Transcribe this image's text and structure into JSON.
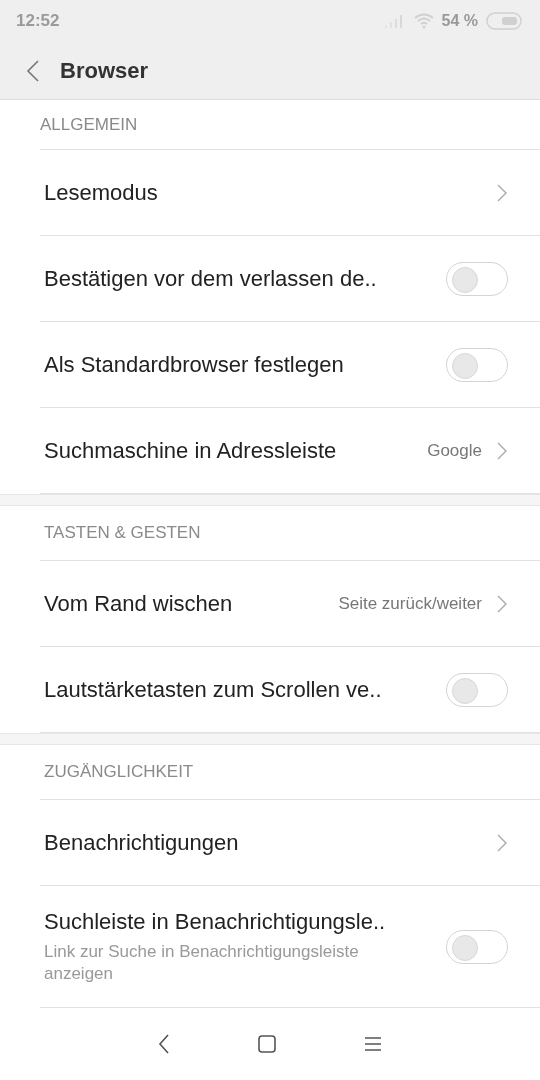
{
  "status_bar": {
    "time": "12:52",
    "battery": "54 %"
  },
  "header": {
    "title": "Browser"
  },
  "sections": [
    {
      "title": "ALLGEMEIN",
      "rows": [
        {
          "kind": "link",
          "label": "Lesemodus"
        },
        {
          "kind": "toggle",
          "label": "Bestätigen vor dem verlassen de..",
          "on": false
        },
        {
          "kind": "toggle",
          "label": "Als Standardbrowser festlegen",
          "on": false
        },
        {
          "kind": "link",
          "label": "Suchmaschine in Adressleiste",
          "value": "Google"
        }
      ]
    },
    {
      "title": "TASTEN & GESTEN",
      "rows": [
        {
          "kind": "link",
          "label": "Vom Rand wischen",
          "value": "Seite zurück/weiter"
        },
        {
          "kind": "toggle",
          "label": "Lautstärketasten zum Scrollen ve..",
          "on": false
        }
      ]
    },
    {
      "title": "ZUGÄNGLICHKEIT",
      "rows": [
        {
          "kind": "link",
          "label": "Benachrichtigungen"
        },
        {
          "kind": "toggle",
          "label": "Suchleiste in Benachrichtigungsle..",
          "description": "Link zur Suche in Benachrichtigungsleiste anzeigen",
          "on": false
        }
      ]
    }
  ]
}
